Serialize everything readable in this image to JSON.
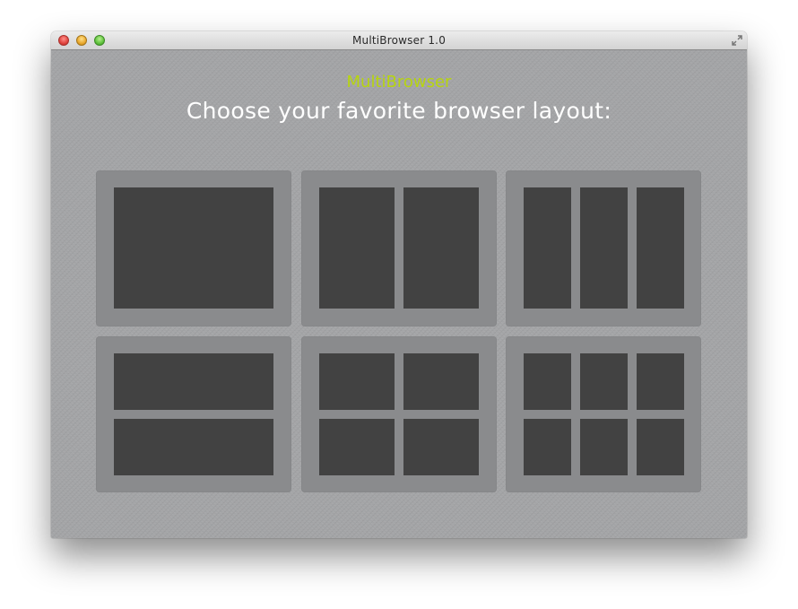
{
  "window": {
    "title": "MultiBrowser 1.0"
  },
  "header": {
    "app_name": "MultiBrowser",
    "prompt": "Choose your favorite browser layout:"
  },
  "layouts": [
    {
      "id": "single",
      "columns": 1,
      "rows": 1
    },
    {
      "id": "two-columns",
      "columns": 2,
      "rows": 1
    },
    {
      "id": "three-columns",
      "columns": 3,
      "rows": 1
    },
    {
      "id": "two-rows",
      "columns": 1,
      "rows": 2
    },
    {
      "id": "grid-2x2",
      "columns": 2,
      "rows": 2
    },
    {
      "id": "grid-3x2",
      "columns": 3,
      "rows": 2
    }
  ],
  "colors": {
    "accent": "#b7d50f",
    "pane": "#424242",
    "tile": "#8a8b8d",
    "background": "#a2a3a5"
  },
  "icons": {
    "close": "close-button",
    "minimize": "minimize-button",
    "zoom": "zoom-button",
    "fullscreen": "fullscreen-icon"
  }
}
